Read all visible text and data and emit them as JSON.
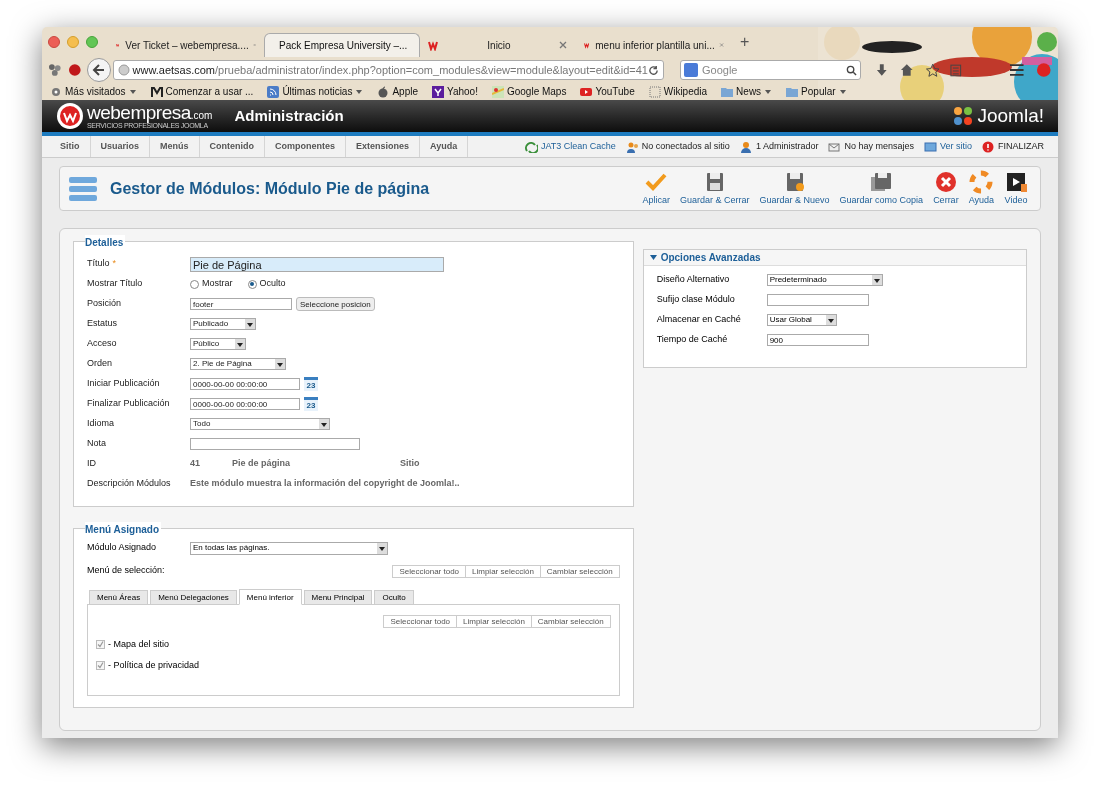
{
  "browser": {
    "tabs": [
      {
        "label": "Ver Ticket – webempresa....",
        "selected": false
      },
      {
        "label": "Pack Empresa University –...",
        "selected": true
      },
      {
        "label": "Inicio",
        "selected": false
      },
      {
        "label": "menu inferior plantilla uni...",
        "selected": false
      }
    ],
    "new_tab": "+",
    "url_host": "www.aetsas.com",
    "url_path": "/prueba/administrator/index.php?option=com_modules&view=module&layout=edit&id=41",
    "search_placeholder": "Google",
    "bookmarks": [
      {
        "label": "Más visitados",
        "dropdown": true
      },
      {
        "label": "Comenzar a usar ...",
        "dropdown": false
      },
      {
        "label": "Últimas noticias",
        "dropdown": true
      },
      {
        "label": "Apple",
        "dropdown": false
      },
      {
        "label": "Yahoo!",
        "dropdown": false
      },
      {
        "label": "Google Maps",
        "dropdown": false
      },
      {
        "label": "YouTube",
        "dropdown": false
      },
      {
        "label": "Wikipedia",
        "dropdown": false
      },
      {
        "label": "News",
        "dropdown": true
      },
      {
        "label": "Popular",
        "dropdown": true
      }
    ]
  },
  "header": {
    "logo": "webempresa",
    "logo_suffix": ".com",
    "tagline": "SERVICIOS PROFESIONALES JOOMLA",
    "title": "Administración",
    "brand": "Joomla!"
  },
  "menu": [
    "Sitio",
    "Usuarios",
    "Menús",
    "Contenido",
    "Componentes",
    "Extensiones",
    "Ayuda"
  ],
  "status": [
    {
      "label": "JAT3 Clean Cache",
      "kind": "cache"
    },
    {
      "label": "No conectados al sitio",
      "kind": "users"
    },
    {
      "label": "1 Administrador",
      "kind": "user"
    },
    {
      "label": "No hay mensajes",
      "kind": "mail"
    },
    {
      "label": "Ver sitio",
      "kind": "site"
    },
    {
      "label": "FINALIZAR",
      "kind": "logout"
    }
  ],
  "page_title": "Gestor de Módulos: Módulo Pie de página",
  "actions": [
    {
      "label": "Aplicar",
      "kind": "apply"
    },
    {
      "label": "Guardar & Cerrar",
      "kind": "save"
    },
    {
      "label": "Guardar & Nuevo",
      "kind": "savenew"
    },
    {
      "label": "Guardar como Copia",
      "kind": "copy"
    },
    {
      "label": "Cerrar",
      "kind": "close"
    },
    {
      "label": "Ayuda",
      "kind": "help"
    },
    {
      "label": "Video",
      "kind": "video"
    }
  ],
  "details": {
    "legend": "Detalles",
    "fields": [
      {
        "kind": "title",
        "label": "Título",
        "required_mark": "*",
        "value": "Pie de Página"
      },
      {
        "kind": "radio",
        "label": "Mostrar Título",
        "options": [
          {
            "label": "Mostrar",
            "selected": false
          },
          {
            "label": "Oculto",
            "selected": true
          }
        ]
      },
      {
        "kind": "position",
        "label": "Posición",
        "value": "footer",
        "button": "Seleccione posicion"
      },
      {
        "kind": "select",
        "label": "Estatus",
        "value": "Publicado"
      },
      {
        "kind": "select",
        "label": "Acceso",
        "value": "Público"
      },
      {
        "kind": "select",
        "label": "Orden",
        "value": "2. Pie de Página"
      },
      {
        "kind": "date",
        "label": "Iniciar Publicación",
        "value": "0000-00-00 00:00:00",
        "calendar": "23"
      },
      {
        "kind": "date",
        "label": "Finalizar Publicación",
        "value": "0000-00-00 00:00:00",
        "calendar": "23"
      },
      {
        "kind": "select",
        "label": "Idioma",
        "value": "Todo"
      },
      {
        "kind": "text",
        "label": "Nota"
      },
      {
        "kind": "info",
        "label": "ID",
        "values": [
          "41",
          "Pie de página",
          "Sitio"
        ]
      },
      {
        "kind": "info",
        "label": "Descripción Módulos",
        "values": [
          "Este módulo muestra la información del copyright de Joomla!.."
        ]
      }
    ]
  },
  "advanced": {
    "legend": "Opciones Avanzadas",
    "expanded": true,
    "fields": [
      {
        "kind": "select",
        "label": "Diseño Alternativo",
        "value": "Predeterminado"
      },
      {
        "kind": "text",
        "label": "Sufijo clase Módulo"
      },
      {
        "kind": "select",
        "label": "Almacenar en Caché",
        "value": "Usar Global"
      },
      {
        "kind": "text",
        "label": "Tiempo de Caché",
        "value": "900"
      }
    ]
  },
  "assignment": {
    "legend": "Menú Asignado",
    "module_label": "Módulo Asignado",
    "module_value": "En todas las páginas.",
    "selection_label": "Menú de selección:",
    "buttons": [
      "Seleccionar todo",
      "Limpiar selección",
      "Cambiar selección"
    ],
    "tabs": [
      {
        "label": "Menú Áreas",
        "selected": false
      },
      {
        "label": "Menú Delegaciones",
        "selected": false
      },
      {
        "label": "Menú inferior",
        "selected": true
      },
      {
        "label": "Menu Principal",
        "selected": false
      },
      {
        "label": "Oculto",
        "selected": false
      }
    ],
    "tab_buttons": [
      "Seleccionar todo",
      "Limpiar selección",
      "Cambiar selección"
    ],
    "items": [
      {
        "label": "- Mapa del sitio",
        "checked": true
      },
      {
        "label": "- Política de privacidad",
        "checked": true
      }
    ]
  }
}
